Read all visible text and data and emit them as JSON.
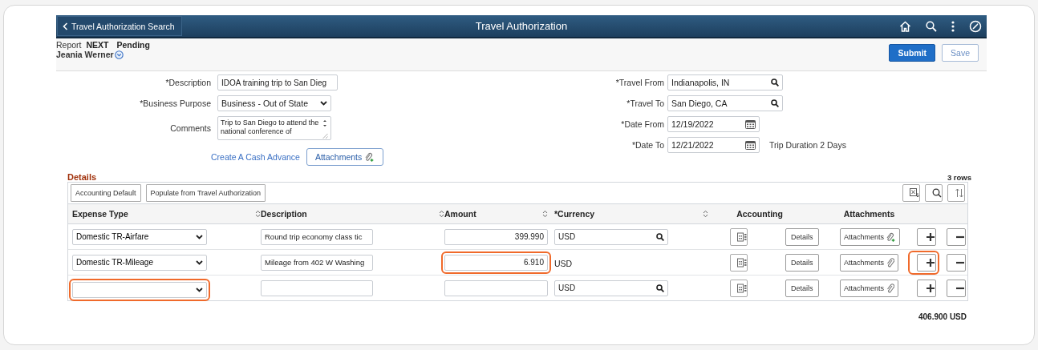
{
  "header": {
    "back_button": "Travel Authorization Search",
    "title": "Travel Authorization"
  },
  "subheader": {
    "report_label": "Report",
    "report_id": "NEXT",
    "status": "Pending",
    "employee": "Jeania Werner"
  },
  "actions": [
    {
      "label": "Submit",
      "primary": true
    },
    {
      "label": "Save",
      "primary": false
    }
  ],
  "form_left": [
    {
      "kind": "text",
      "label": "*Description",
      "value": "IDOA training trip to San Dieg"
    },
    {
      "kind": "select",
      "label": "*Business Purpose",
      "value": "Business - Out of State"
    },
    {
      "kind": "textarea",
      "label": "Comments",
      "value": "Trip to San Diego to attend the national conference of"
    }
  ],
  "form_right": [
    {
      "kind": "lookup",
      "label": "*Travel From",
      "value": "Indianapolis, IN"
    },
    {
      "kind": "lookup",
      "label": "*Travel To",
      "value": "San Diego, CA"
    },
    {
      "kind": "date",
      "label": "*Date From",
      "value": "12/19/2022"
    },
    {
      "kind": "date",
      "label": "*Date To",
      "value": "12/21/2022",
      "note": "Trip Duration 2 Days"
    }
  ],
  "cash_advance_link": "Create A Cash Advance",
  "attachments_button": "Attachments",
  "details": {
    "title": "Details",
    "row_count": "3 rows",
    "toolbar_buttons": [
      "Accounting Default",
      "Populate from Travel Authorization"
    ],
    "columns": [
      {
        "label": "Expense Type",
        "sortable": true
      },
      {
        "label": "Description",
        "sortable": true
      },
      {
        "label": "Amount",
        "sortable": true
      },
      {
        "label": "*Currency",
        "sortable": true
      },
      {
        "label": "Accounting",
        "sortable": false
      },
      {
        "label": "Attachments",
        "sortable": false
      }
    ],
    "rows": [
      {
        "expense_type": "Domestic TR-Airfare",
        "expense_highlighted": false,
        "description": "Round trip economy class tic",
        "amount": "399.990",
        "amount_highlighted": false,
        "currency": "USD",
        "currency_editable": true,
        "details": "Details",
        "attachments": "Attachments",
        "attachment_plus": true,
        "add_highlighted": false
      },
      {
        "expense_type": "Domestic TR-Mileage",
        "expense_highlighted": false,
        "description": "Mileage from 402 W Washing",
        "amount": "6.910",
        "amount_highlighted": true,
        "currency": "USD",
        "currency_editable": false,
        "details": "Details",
        "attachments": "Attachments",
        "attachment_plus": false,
        "add_highlighted": true
      },
      {
        "expense_highlighted": true,
        "amount_highlighted": false,
        "currency": "USD",
        "currency_editable": true,
        "details": "Details",
        "attachments": "Attachments",
        "attachment_plus": false,
        "add_highlighted": false
      }
    ],
    "total": "406.900 USD"
  }
}
